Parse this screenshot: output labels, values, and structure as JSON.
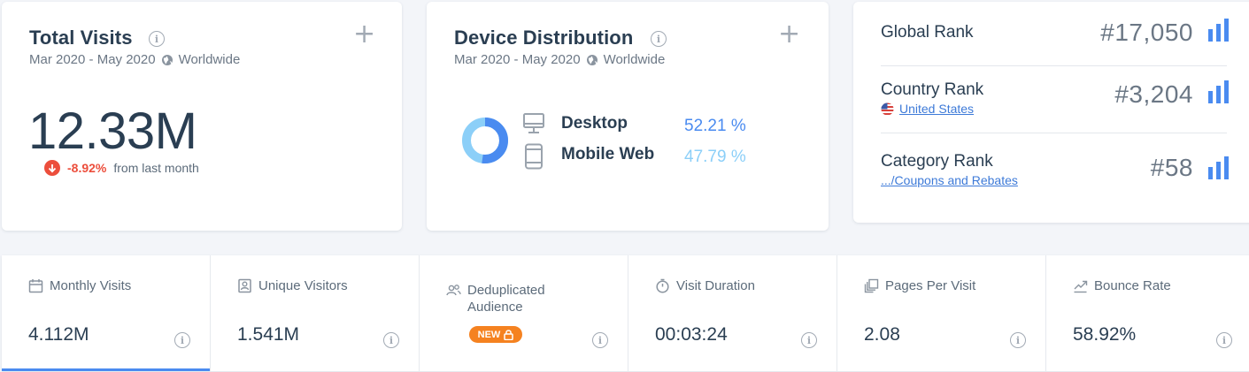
{
  "visits": {
    "title": "Total Visits",
    "period": "Mar 2020 - May 2020",
    "region": "Worldwide",
    "value": "12.33M",
    "change": "-8.92%",
    "change_text": "from last month"
  },
  "devices": {
    "title": "Device Distribution",
    "period": "Mar 2020 - May 2020",
    "region": "Worldwide",
    "items": [
      {
        "name": "Desktop",
        "pct": "52.21 %",
        "color": "#4a8bf0"
      },
      {
        "name": "Mobile Web",
        "pct": "47.79 %",
        "color": "#8ccff8"
      }
    ]
  },
  "ranks": {
    "global": {
      "label": "Global Rank",
      "value": "#17,050"
    },
    "country": {
      "label": "Country Rank",
      "link": "United States",
      "value": "#3,204"
    },
    "category": {
      "label": "Category Rank",
      "link": ".../Coupons and Rebates",
      "value": "#58"
    }
  },
  "metrics": [
    {
      "label": "Monthly Visits",
      "value": "4.112M",
      "icon": "calendar-icon"
    },
    {
      "label": "Unique Visitors",
      "value": "1.541M",
      "icon": "user-badge-icon"
    },
    {
      "label": "Deduplicated Audience",
      "value": "",
      "badge": "NEW",
      "icon": "people-icon"
    },
    {
      "label": "Visit Duration",
      "value": "00:03:24",
      "icon": "timer-icon"
    },
    {
      "label": "Pages Per Visit",
      "value": "2.08",
      "icon": "pages-icon"
    },
    {
      "label": "Bounce Rate",
      "value": "58.92%",
      "icon": "trend-icon"
    }
  ],
  "colors": {
    "accent": "#4a8bf0",
    "negative": "#ec4e3c",
    "badge": "#f58220"
  }
}
